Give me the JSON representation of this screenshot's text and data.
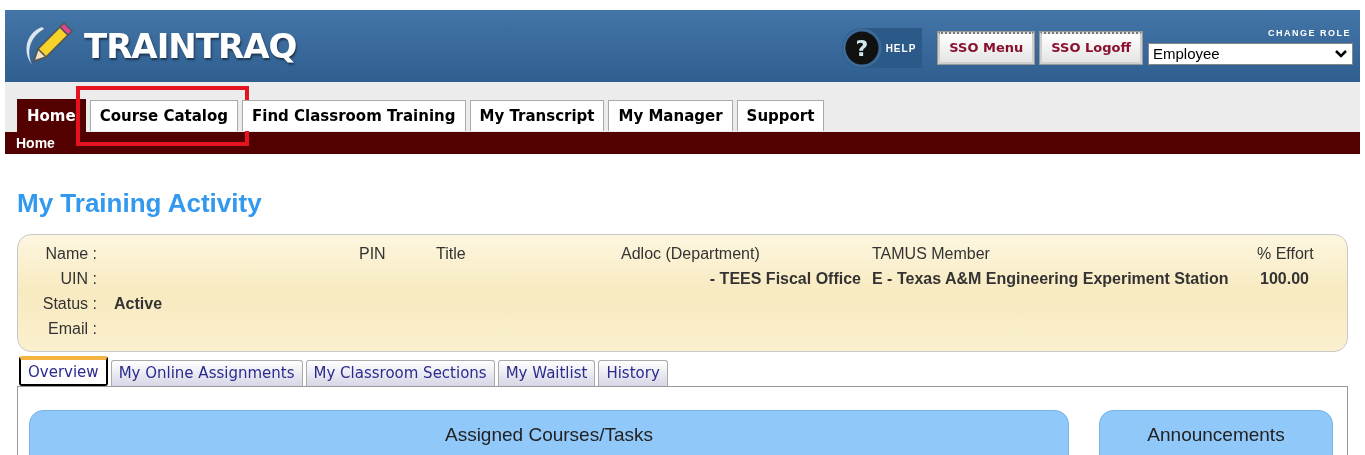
{
  "header": {
    "logo": "TRAINTRAQ",
    "help_glyph": "?",
    "help": "HELP",
    "buttons": [
      "SSO Menu",
      "SSO Logoff"
    ],
    "role_label": "CHANGE ROLE",
    "role_value": "Employee"
  },
  "tabs": [
    {
      "label": "Home",
      "selected": true,
      "highlighted": false
    },
    {
      "label": "Course Catalog",
      "selected": false,
      "highlighted": true
    },
    {
      "label": "Find Classroom Training",
      "selected": false,
      "highlighted": false
    },
    {
      "label": "My Transcript",
      "selected": false,
      "highlighted": false
    },
    {
      "label": "My Manager",
      "selected": false,
      "highlighted": false
    },
    {
      "label": "Support",
      "selected": false,
      "highlighted": false
    }
  ],
  "breadcrumb": "Home",
  "heading": "My Training Activity",
  "profile": {
    "fields": [
      {
        "label": "Name :"
      },
      {
        "label": "UIN :"
      },
      {
        "label": "Status :",
        "value": "Active"
      },
      {
        "label": "Email :"
      }
    ],
    "headers": [
      "PIN",
      "Title",
      "Adloc (Department)",
      "TAMUS Member",
      "% Effort"
    ],
    "department": "- TEES Fiscal Office",
    "member": "E - Texas A&M Engineering Experiment Station",
    "effort": "100.00"
  },
  "subtabs": [
    {
      "label": "Overview",
      "selected": true
    },
    {
      "label": "My Online Assignments",
      "selected": false
    },
    {
      "label": "My Classroom Sections",
      "selected": false
    },
    {
      "label": "My Waitlist",
      "selected": false
    },
    {
      "label": "History",
      "selected": false
    }
  ],
  "panels": [
    "Assigned Courses/Tasks",
    "Announcements"
  ]
}
